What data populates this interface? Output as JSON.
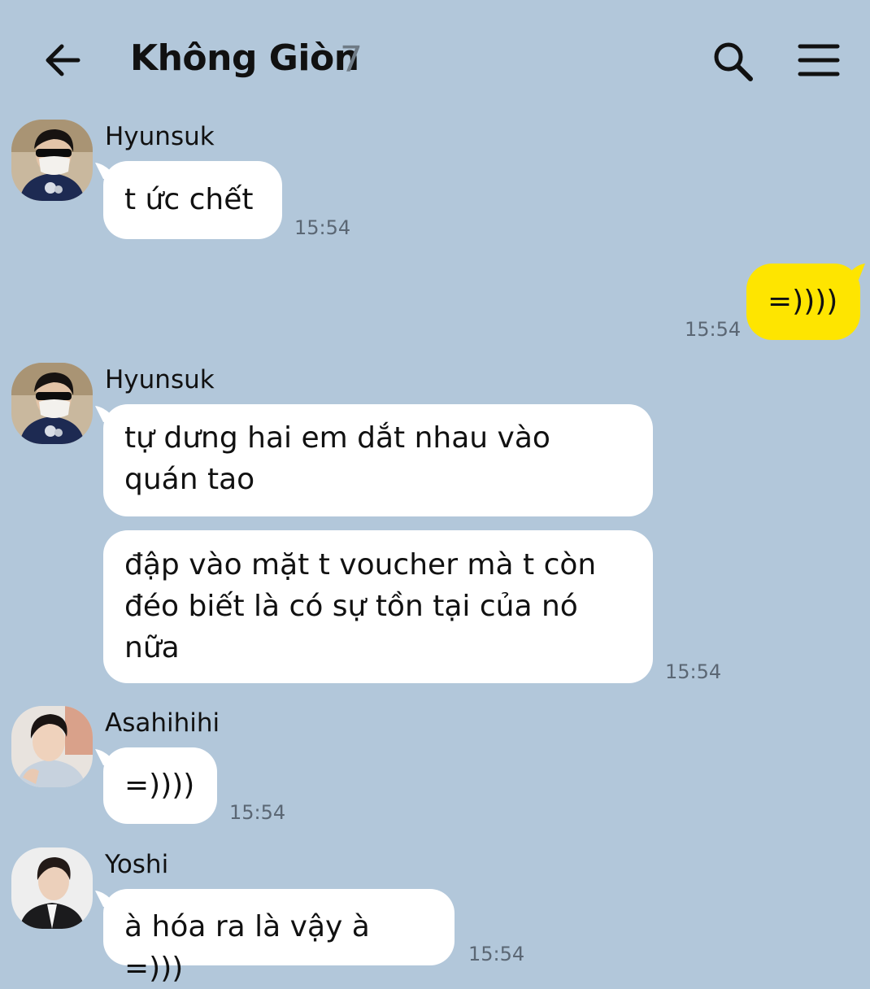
{
  "header": {
    "title": "Không Giòn",
    "member_count": "7",
    "icons": [
      "back-arrow-icon",
      "search-icon",
      "menu-icon"
    ]
  },
  "colors": {
    "background": "#b2c7da",
    "incoming_bubble": "#ffffff",
    "outgoing_bubble": "#fee500",
    "timestamp": "#5b6774"
  },
  "messages": [
    {
      "sender": "Hyunsuk",
      "text": "t ức chết",
      "time": "15:54",
      "direction": "incoming"
    },
    {
      "text": "=))))",
      "time": "15:54",
      "direction": "outgoing"
    },
    {
      "sender": "Hyunsuk",
      "lines": [
        "tự dưng hai em dắt nhau vào",
        "quán tao"
      ],
      "direction": "incoming"
    },
    {
      "lines": [
        "đập vào mặt t voucher mà t còn",
        "đéo biết là có sự tồn tại của nó",
        "nữa"
      ],
      "time": "15:54",
      "direction": "incoming"
    },
    {
      "sender": "Asahihihi",
      "text": "=))))",
      "time": "15:54",
      "direction": "incoming"
    },
    {
      "sender": "Yoshi",
      "text": "à hóa ra là vậy à =)))",
      "time": "15:54",
      "direction": "incoming"
    }
  ]
}
